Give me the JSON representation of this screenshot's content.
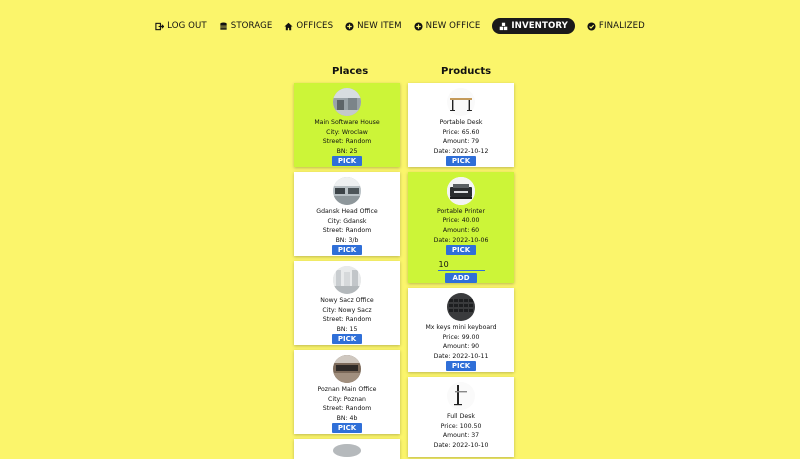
{
  "nav": {
    "items": [
      {
        "label": "LOG OUT",
        "icon": "logout-icon"
      },
      {
        "label": "STORAGE",
        "icon": "database-icon"
      },
      {
        "label": "OFFICES",
        "icon": "home-icon"
      },
      {
        "label": "NEW ITEM",
        "icon": "plus-circle-icon"
      },
      {
        "label": "NEW OFFICE",
        "icon": "plus-circle-icon"
      },
      {
        "label": "INVENTORY",
        "icon": "boxes-icon"
      },
      {
        "label": "FINALIZED",
        "icon": "check-circle-icon"
      }
    ],
    "active": "INVENTORY"
  },
  "places": {
    "title": "Places",
    "items": [
      {
        "name": "Main Software House",
        "city": "City: Wroclaw",
        "street": "Street: Random",
        "bn": "BN: 25",
        "pick": "PICK",
        "selected": true
      },
      {
        "name": "Gdansk Head Office",
        "city": "City: Gdansk",
        "street": "Street: Random",
        "bn": "BN: 3/b",
        "pick": "PICK"
      },
      {
        "name": "Nowy Sacz Office",
        "city": "City: Nowy Sacz",
        "street": "Street: Random",
        "bn": "BN: 15",
        "pick": "PICK"
      },
      {
        "name": "Poznan Main Office",
        "city": "City: Poznan",
        "street": "Street: Random",
        "bn": "BN: 4b",
        "pick": "PICK"
      }
    ]
  },
  "products": {
    "title": "Products",
    "items": [
      {
        "name": "Portable Desk",
        "price": "Price: 65.60",
        "amount": "Amount: 79",
        "date": "Date: 2022-10-12",
        "pick": "PICK"
      },
      {
        "name": "Portable Printer",
        "price": "Price: 40.00",
        "amount": "Amount: 60",
        "date": "Date: 2022-10-06",
        "pick": "PICK",
        "selected": true,
        "qty_value": "10",
        "add": "ADD"
      },
      {
        "name": "Mx keys mini keyboard",
        "price": "Price: 99.00",
        "amount": "Amount: 90",
        "date": "Date: 2022-10-11",
        "pick": "PICK"
      },
      {
        "name": "Full Desk",
        "price": "Price: 100.50",
        "amount": "Amount: 37",
        "date": "Date: 2022-10-10"
      }
    ]
  },
  "colors": {
    "background": "#fbf56b",
    "selected": "#ccf538",
    "button": "#2f6fd8"
  }
}
